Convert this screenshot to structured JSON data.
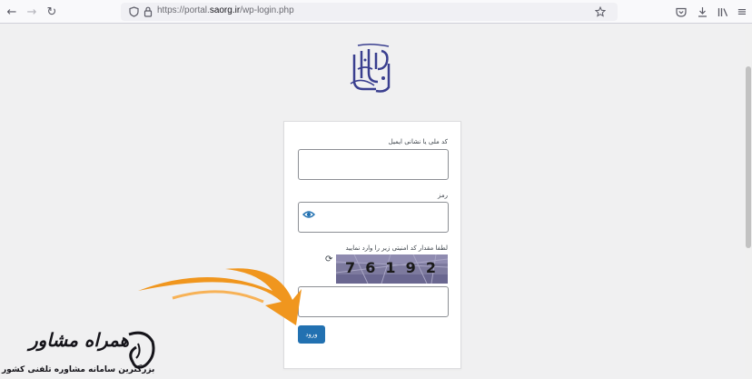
{
  "browser": {
    "url_prefix": "https://portal.",
    "url_domain": "saorg.ir",
    "url_suffix": "/wp-login.php"
  },
  "form": {
    "username_label": "کد ملی یا نشانی ایمیل",
    "username_value": "",
    "password_label": "رمز",
    "password_value": "",
    "captcha_label": "لطفا مقدار کد امنیتی زیر را وارد نمایید",
    "captcha_code": "76192",
    "captcha_value": "",
    "submit_label": "ورود"
  },
  "watermark": {
    "title": "همراه مشاور",
    "subtitle": "بزرگترین سامانه مشاوره تلفنی کشور"
  },
  "colors": {
    "accent": "#2271b1",
    "logo": "#3a3f8f",
    "arrow": "#f0961e"
  }
}
